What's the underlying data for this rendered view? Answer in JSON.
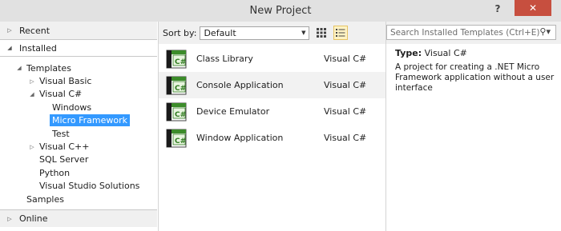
{
  "window": {
    "title": "New Project",
    "help": "?",
    "close": "✕"
  },
  "nav": {
    "recent": "Recent",
    "installed": "Installed",
    "online": "Online",
    "tree": [
      {
        "label": "Templates",
        "indent": 0,
        "arrow": "◢",
        "selected": false
      },
      {
        "label": "Visual Basic",
        "indent": 1,
        "arrow": "▷",
        "selected": false
      },
      {
        "label": "Visual C#",
        "indent": 1,
        "arrow": "◢",
        "selected": false
      },
      {
        "label": "Windows",
        "indent": 2,
        "arrow": "",
        "selected": false
      },
      {
        "label": "Micro Framework",
        "indent": 2,
        "arrow": "",
        "selected": true
      },
      {
        "label": "Test",
        "indent": 2,
        "arrow": "",
        "selected": false
      },
      {
        "label": "Visual C++",
        "indent": 1,
        "arrow": "▷",
        "selected": false
      },
      {
        "label": "SQL Server",
        "indent": 1,
        "arrow": "",
        "selected": false
      },
      {
        "label": "Python",
        "indent": 1,
        "arrow": "",
        "selected": false
      },
      {
        "label": "Visual Studio Solutions",
        "indent": 1,
        "arrow": "",
        "selected": false
      },
      {
        "label": "Samples",
        "indent": 0,
        "arrow": "",
        "selected": false
      }
    ]
  },
  "toolbar": {
    "sort_label": "Sort by:",
    "sort_value": "Default"
  },
  "templates": [
    {
      "name": "Class Library",
      "lang": "Visual C#",
      "selected": false
    },
    {
      "name": "Console Application",
      "lang": "Visual C#",
      "selected": true
    },
    {
      "name": "Device Emulator",
      "lang": "Visual C#",
      "selected": false
    },
    {
      "name": "Window Application",
      "lang": "Visual C#",
      "selected": false
    }
  ],
  "search": {
    "placeholder": "Search Installed Templates (Ctrl+E)"
  },
  "details": {
    "type_label": "Type:",
    "type_value": "Visual C#",
    "description": "A project for creating a .NET Micro Framework application without a user interface"
  }
}
